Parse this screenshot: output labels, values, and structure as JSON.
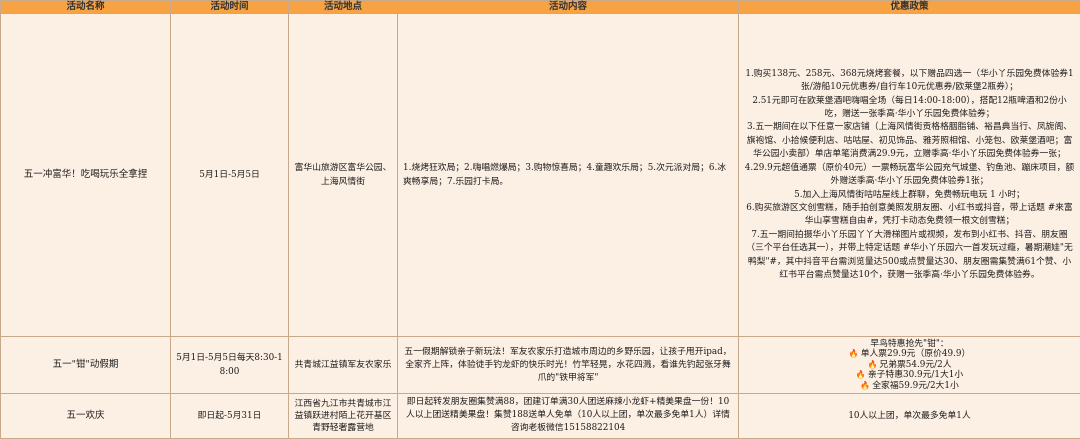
{
  "headers": [
    "活动名称",
    "活动时间",
    "活动地点",
    "活动内容",
    "优惠政策"
  ],
  "rows": [
    {
      "name": "五一冲富华！吃喝玩乐全拿捏",
      "time": "5月1日-5月5日",
      "location": "富华山旅游区富华公园、上海风情街",
      "content": "1.烧烤狂欢局；2.嗨唱燃爆局；3.购物惊喜局；4.童趣欢乐局；5.次元派对局；6.冰爽畅享局；7.乐园打卡局。",
      "policy": [
        "1.购买138元、258元、368元烧烤套餐，以下赠品四选一（华小丫乐园免费体验券1张/游船10元优惠券/自行车10元优惠券/欧莱堡2瓶券）；",
        "2.51元即可在欧莱堡酒吧嗨唱全场（每日14:00-18:00），搭配12瓶啤酒和2份小吃，赠送一张季高·华小丫乐园免费体验券；",
        "3.五一期间在以下任意一家店铺（上海风情街贡格格胭脂铺、裕昌典当行、凤旎阁、旗袍馆、小拾候便利店、咕咕屋、初见饰品、雅芳照相馆、小笼包、欧莱堡酒吧；富华公园小卖部）单店单笔消费满29.9元，立赠季高·华小丫乐园免费体验券一张；",
        "4.29.9元超值通票（原价40元）一票畅玩富华公园充气城堡、钓鱼池、蹦床项目，额外赠送季高·华小丫乐园免费体验券1张；",
        "5.加入上海风情街咕咕屋线上群聊，免费畅玩电玩 1 小时；",
        "6.购买旅游区文创雪糕，随手拍创意美照发朋友圈、小红书或抖音，带上话题 #来富华山享雪糕自由#，凭打卡动态免费领一根文创雪糕；",
        "7.五一期间拍摄华小丫乐园丫丫大滑梯图片或视频，发布到小红书、抖音、朋友圈（三个平台任选其一），并带上特定话题 #华小丫乐园六一首发玩过瘾，暑期潮娃\"无鸭梨\"#，其中抖音平台需浏览量达500或点赞量达30、朋友圈需集赞满61个赞、小红书平台需点赞量达10个，获赠一张季高·华小丫乐园免费体验券。"
      ]
    },
    {
      "name": "五一\"钳\"动假期",
      "time": "5月1日-5月5日每天8:30-18:00",
      "location": "共青城江益镇军友农家乐",
      "content": "五一假期解锁亲子新玩法！军友农家乐打造城市周边的乡野乐园，让孩子甩开ipad，全家齐上阵，体验徒手钓龙虾的快乐时光！竹竿轻晃，水花四溅，看谁先钓起张牙舞爪的\"铁甲将军\"",
      "policy_title": "早鸟特惠抢先\"钳\"：",
      "policy_fire_items": [
        "单人票29.9元（原价49.9）",
        "兄弟票54.9元/2人",
        "亲子特惠30.9元/1大1小",
        "全家福59.9元/2大1小"
      ],
      "fire_icon": "fire-icon"
    },
    {
      "name": "五一欢庆",
      "time": "即日起-5月31日",
      "location": "江西省九江市共青城市江益镇跃进村陌上花开基区青野轻奢露营地",
      "content": "即日起转发朋友圈集赞满88，团建订单满30人团送麻辣小龙虾+精美果盘一份！10人以上团送精美果盘！集赞188送单人免单（10人以上团，单次最多免单1人）详情咨询老板微信15158822104",
      "policy": "10人以上团，单次最多免单1人"
    }
  ]
}
